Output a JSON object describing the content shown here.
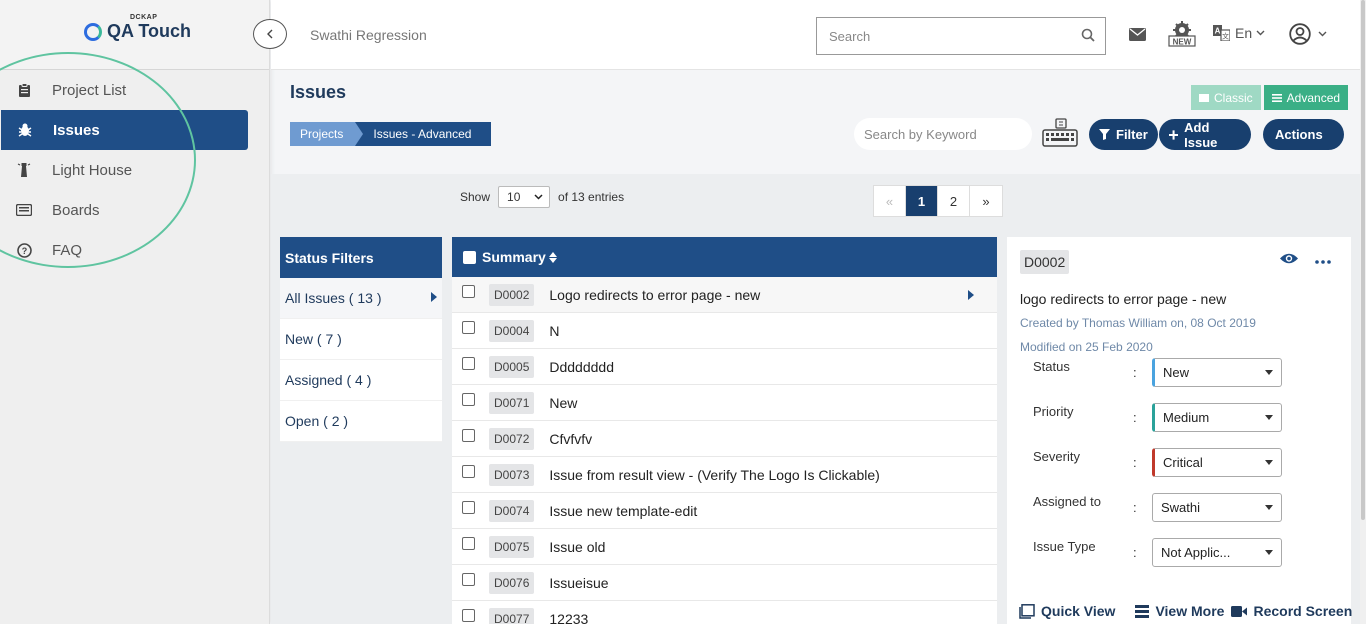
{
  "app": {
    "logo_small": "DCKAP",
    "logo_text": "QA Touch"
  },
  "sidebar": {
    "items": [
      {
        "label": "Project List",
        "icon": "clipboard-icon"
      },
      {
        "label": "Issues",
        "icon": "bug-icon"
      },
      {
        "label": "Light House",
        "icon": "lighthouse-icon"
      },
      {
        "label": "Boards",
        "icon": "boards-icon"
      },
      {
        "label": "FAQ",
        "icon": "help-icon"
      }
    ]
  },
  "topbar": {
    "project": "Swathi Regression",
    "search_placeholder": "Search",
    "lang": "En"
  },
  "page": {
    "title": "Issues",
    "view_classic": "Classic",
    "view_advanced": "Advanced",
    "crumbs": [
      "Projects",
      "Issues - Advanced"
    ],
    "keyword_placeholder": "Search by Keyword",
    "filter_label": "Filter",
    "add_issue_label": "Add Issue",
    "actions_label": "Actions"
  },
  "table_controls": {
    "show_label": "Show",
    "page_size": "10",
    "entries_label": "of 13 entries",
    "pager": [
      "«",
      "1",
      "2",
      "»"
    ],
    "current_page": "1"
  },
  "filters": {
    "title": "Status Filters",
    "items": [
      "All Issues ( 13 )",
      "New ( 7 )",
      "Assigned ( 4 )",
      "Open ( 2 )"
    ]
  },
  "issues": {
    "header": "Summary",
    "rows": [
      {
        "id": "D0002",
        "summary": "Logo redirects to error page - new"
      },
      {
        "id": "D0004",
        "summary": "N"
      },
      {
        "id": "D0005",
        "summary": "Dddddddd"
      },
      {
        "id": "D0071",
        "summary": "New"
      },
      {
        "id": "D0072",
        "summary": "Cfvfvfv"
      },
      {
        "id": "D0073",
        "summary": "Issue from result view - (Verify The Logo Is Clickable)"
      },
      {
        "id": "D0074",
        "summary": "Issue new template-edit"
      },
      {
        "id": "D0075",
        "summary": "Issue old"
      },
      {
        "id": "D0076",
        "summary": "Issueisue"
      },
      {
        "id": "D0077",
        "summary": "12233"
      }
    ]
  },
  "detail": {
    "id": "D0002",
    "title": "logo redirects to error page - new",
    "created": "Created by Thomas William on, 08 Oct 2019",
    "modified": "Modified on 25 Feb 2020",
    "colon": ":",
    "fields": [
      {
        "label": "Status",
        "value": "New"
      },
      {
        "label": "Priority",
        "value": "Medium"
      },
      {
        "label": "Severity",
        "value": "Critical"
      },
      {
        "label": "Assigned to",
        "value": "Swathi"
      },
      {
        "label": "Issue Type",
        "value": "Not Applic..."
      }
    ],
    "quick_view": "Quick View",
    "view_more": "View More",
    "record_screen": "Record Screen"
  },
  "colors": {
    "primary": "#1f4e87",
    "dark_pill": "#183f6e",
    "accent_green": "#3aaf86",
    "highlight_circle": "#5fc4a0"
  }
}
